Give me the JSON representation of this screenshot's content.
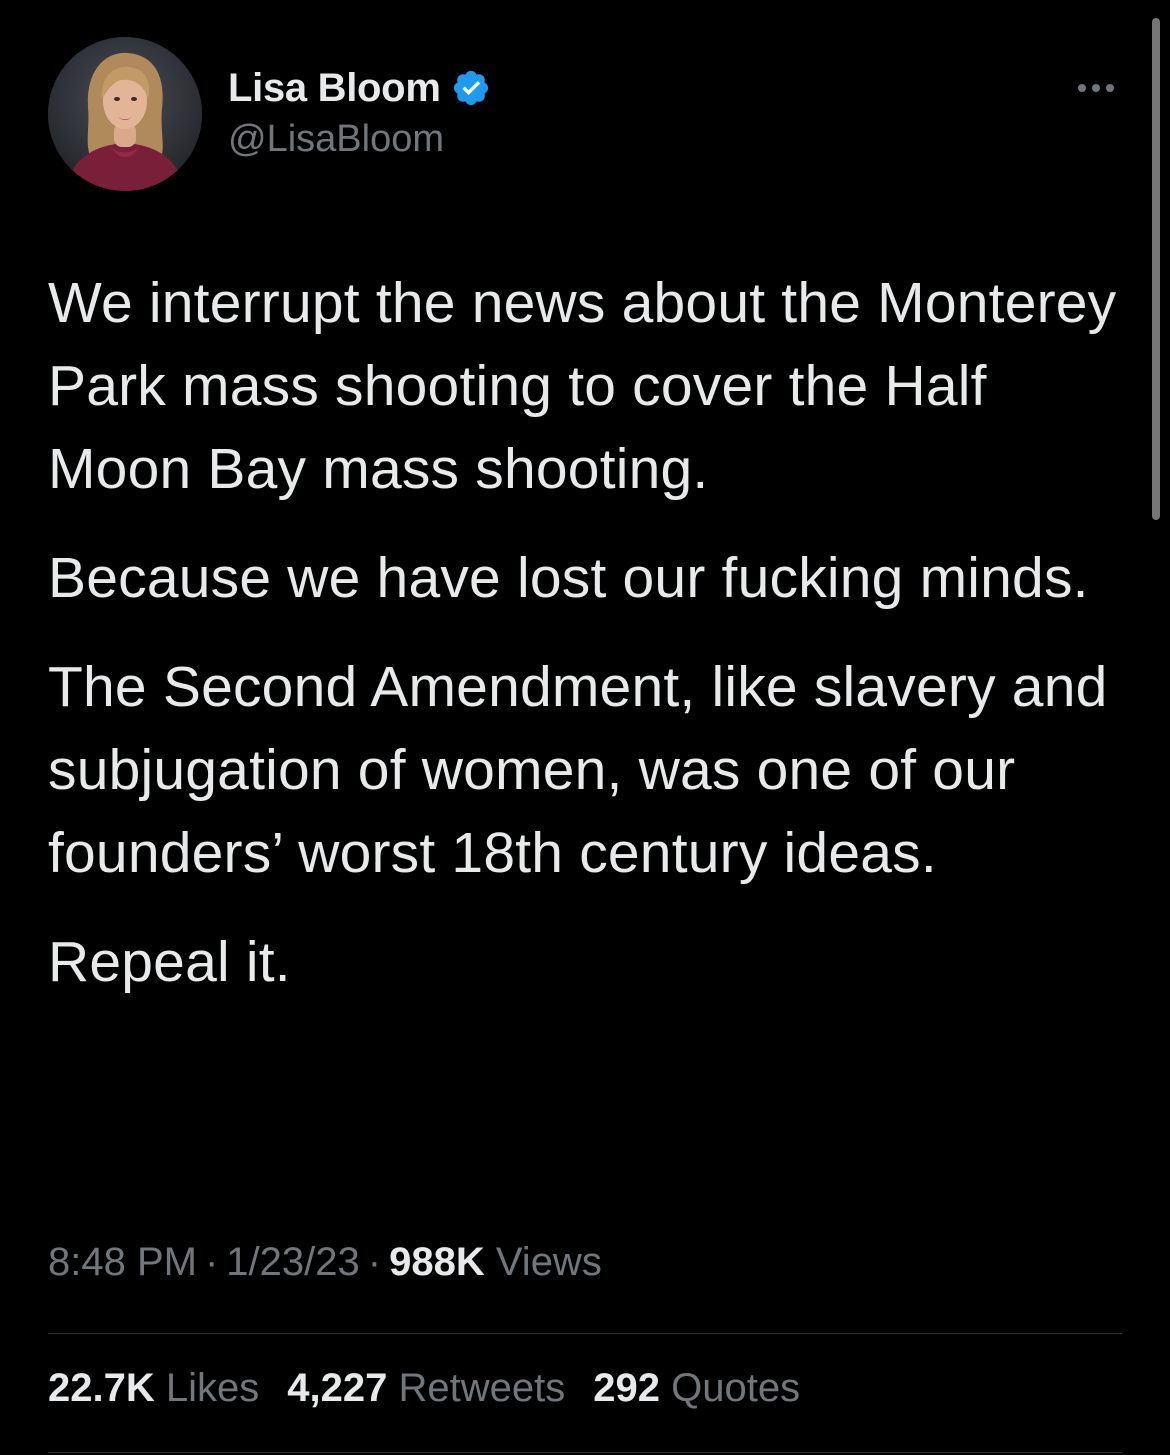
{
  "author": {
    "display_name": "Lisa Bloom",
    "handle": "@LisaBloom",
    "verified": true,
    "verified_color": "#1d9bf0"
  },
  "tweet": {
    "paragraphs": [
      "We interrupt the news about the Monterey Park mass shooting to cover the Half Moon Bay mass shooting.",
      "Because we have lost our fucking minds.",
      "The Second Amendment, like slavery and subjugation of women, was one of our founders’ worst 18th century ideas.",
      "Repeal it."
    ]
  },
  "meta": {
    "time": "8:48 PM",
    "separator": "·",
    "date": "1/23/23",
    "views_count": "988K",
    "views_label": "Views"
  },
  "stats": {
    "likes_count": "22.7K",
    "likes_label": "Likes",
    "retweets_count": "4,227",
    "retweets_label": "Retweets",
    "quotes_count": "292",
    "quotes_label": "Quotes"
  },
  "colors": {
    "background": "#000000",
    "text_primary": "#e7e9ea",
    "text_secondary": "#71767b",
    "divider": "#2f3336"
  },
  "icons": {
    "verified": "verified-badge-icon",
    "more": "more-options-icon"
  }
}
